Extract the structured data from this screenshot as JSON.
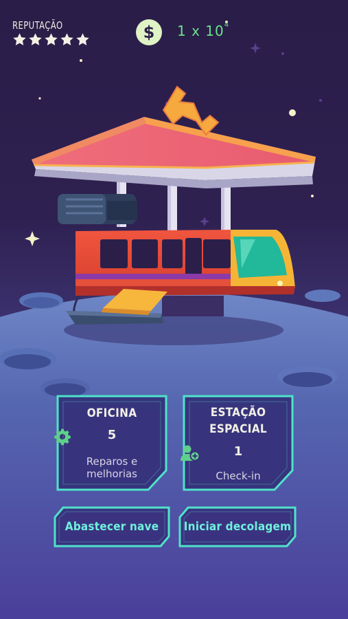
{
  "hud": {
    "reputation_label": "REPUTAÇÃO",
    "reputation_stars": 5,
    "reputation_max": 5,
    "currency_symbol": "$",
    "money_base": "1 x 10",
    "money_exponent": "4"
  },
  "cards": {
    "workshop": {
      "title": "OFICINA",
      "count": "5",
      "subtitle_line1": "Reparos e",
      "subtitle_line2": "melhorias",
      "icon": "gear-icon"
    },
    "station": {
      "title_line1": "ESTAÇÃO",
      "title_line2": "ESPACIAL",
      "count": "1",
      "subtitle": "Check-in",
      "icon": "add-user-icon"
    }
  },
  "buttons": {
    "refuel": "Abastecer nave",
    "takeoff": "Iniciar decolagem"
  },
  "colors": {
    "accent_teal": "#4fe3c9",
    "money_green": "#69e38a",
    "icon_green": "#5fd08a",
    "panel_fill": "#35307a"
  }
}
